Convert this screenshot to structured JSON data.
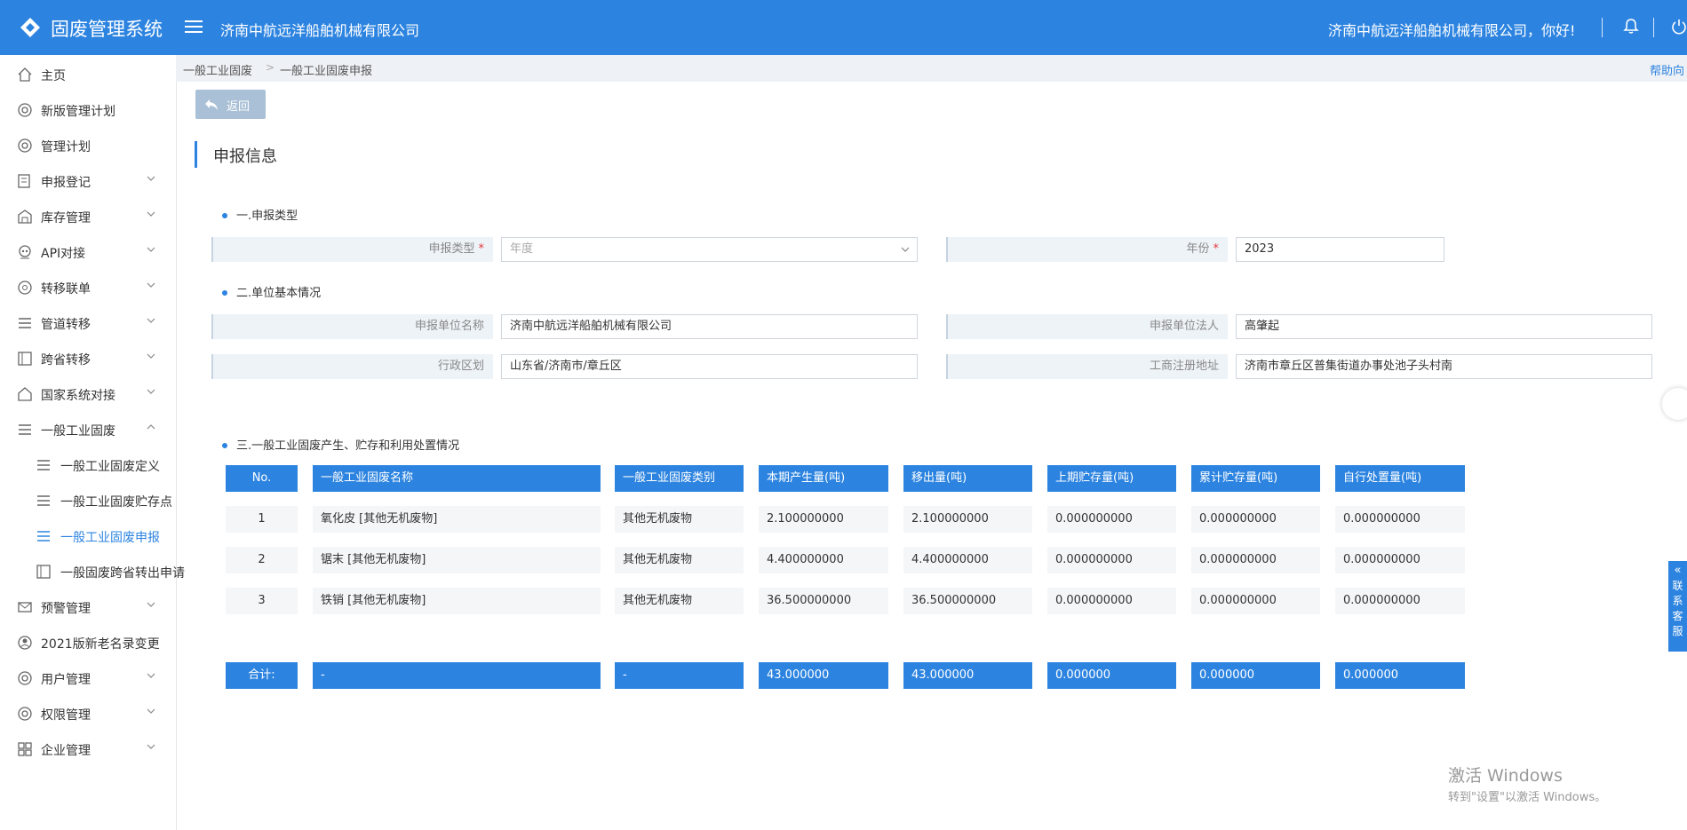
{
  "header": {
    "app_title": "固废管理系统",
    "company": "济南中航远洋船舶机械有限公司",
    "greeting": "济南中航远洋船舶机械有限公司，你好!",
    "brand_color": "#2d84e0"
  },
  "sidebar": {
    "items": [
      {
        "label": "主页",
        "icon": "home-icon"
      },
      {
        "label": "新版管理计划",
        "icon": "gear-icon"
      },
      {
        "label": "管理计划",
        "icon": "gear-icon"
      },
      {
        "label": "申报登记",
        "icon": "edit-document-icon"
      },
      {
        "label": "库存管理",
        "icon": "warehouse-icon"
      },
      {
        "label": "API对接",
        "icon": "robot-icon"
      },
      {
        "label": "转移联单",
        "icon": "transfer-icon"
      },
      {
        "label": "管道转移",
        "icon": "list-icon"
      },
      {
        "label": "跨省转移",
        "icon": "route-icon"
      },
      {
        "label": "国家系统对接",
        "icon": "flag-icon"
      },
      {
        "label": "一般工业固废",
        "icon": "list-icon"
      },
      {
        "label": "一般工业固废定义",
        "icon": "list-icon"
      },
      {
        "label": "一般工业固废贮存点",
        "icon": "list-icon"
      },
      {
        "label": "一般工业固废申报",
        "icon": "list-icon"
      },
      {
        "label": "一般固废跨省转出申请",
        "icon": "route-icon"
      },
      {
        "label": "预警管理",
        "icon": "mail-icon"
      },
      {
        "label": "2021版新老名录变更",
        "icon": "user-circle-icon"
      },
      {
        "label": "用户管理",
        "icon": "gear-icon"
      },
      {
        "label": "权限管理",
        "icon": "gear-icon"
      },
      {
        "label": "企业管理",
        "icon": "grid-icon"
      }
    ]
  },
  "breadcrumb": {
    "items": [
      "一般工业固废",
      "一般工业固废申报"
    ],
    "separator": ">",
    "help": "帮助向"
  },
  "back_button": "返回",
  "section_title": "申报信息",
  "form": {
    "group1_title": "一.申报类型",
    "type_label": "申报类型",
    "type_placeholder": "年度",
    "year_label": "年份",
    "year_value": "2023",
    "required_mark": "*",
    "group2_title": "二.单位基本情况",
    "unit_name_label": "申报单位名称",
    "unit_name_value": "济南中航远洋船舶机械有限公司",
    "legal_person_label": "申报单位法人",
    "legal_person_value": "高肇起",
    "region_label": "行政区划",
    "region_value": "山东省/济南市/章丘区",
    "address_label": "工商注册地址",
    "address_value": "济南市章丘区普集街道办事处池子头村南"
  },
  "table": {
    "title": "三.一般工业固废产生、贮存和利用处置情况",
    "columns": [
      "No.",
      "一般工业固废名称",
      "一般工业固废类别",
      "本期产生量(吨)",
      "移出量(吨)",
      "上期贮存量(吨)",
      "累计贮存量(吨)",
      "自行处置量(吨)"
    ],
    "rows": [
      [
        "1",
        "氧化皮 [其他无机废物]",
        "其他无机废物",
        "2.100000000",
        "2.100000000",
        "0.000000000",
        "0.000000000",
        "0.000000000"
      ],
      [
        "2",
        "锯末 [其他无机废物]",
        "其他无机废物",
        "4.400000000",
        "4.400000000",
        "0.000000000",
        "0.000000000",
        "0.000000000"
      ],
      [
        "3",
        "铁销 [其他无机废物]",
        "其他无机废物",
        "36.500000000",
        "36.500000000",
        "0.000000000",
        "0.000000000",
        "0.000000000"
      ]
    ],
    "footer": [
      "合计:",
      "-",
      "-",
      "43.000000",
      "43.000000",
      "0.000000",
      "0.000000",
      "0.000000"
    ]
  },
  "activation": {
    "title": "激活 Windows",
    "subtitle": "转到\"设置\"以激活 Windows。"
  },
  "side_tab": {
    "arrow": "«",
    "label": "联系客服"
  }
}
